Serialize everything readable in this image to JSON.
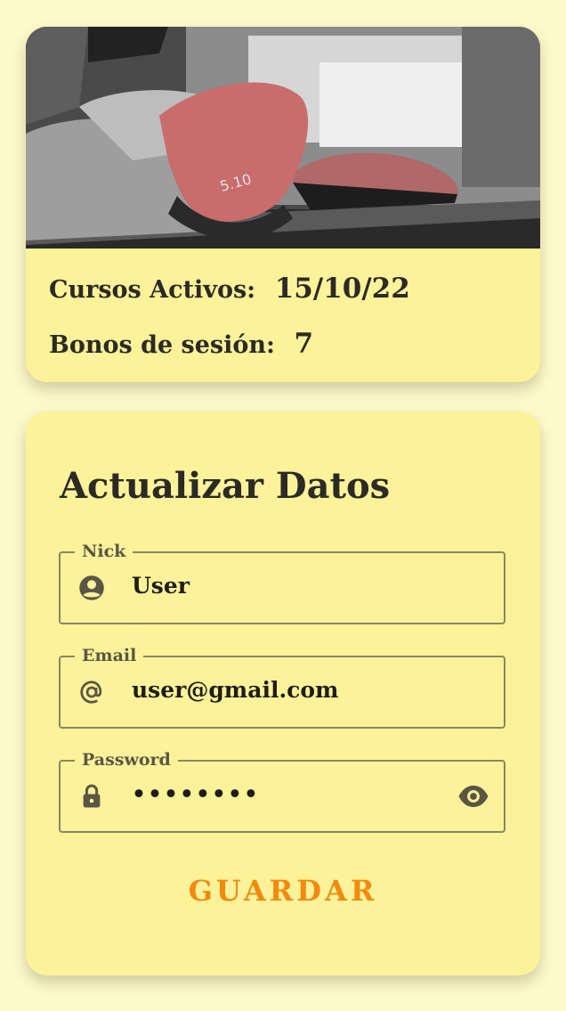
{
  "profile": {
    "cursos_label": "Cursos Activos:",
    "cursos_value": "15/10/22",
    "bonos_label": "Bonos de sesión:",
    "bonos_value": "7"
  },
  "form": {
    "title": "Actualizar Datos",
    "fields": [
      {
        "label": "Nick",
        "value": "User",
        "icon": "account-circle-icon"
      },
      {
        "label": "Email",
        "value": "user@gmail.com",
        "icon": "at-sign-icon"
      },
      {
        "label": "Password",
        "value": "••••••••",
        "icon": "lock-icon",
        "trailing_icon": "eye-icon"
      }
    ],
    "save_label": "GUARDAR"
  },
  "colors": {
    "background": "#fdf9c8",
    "card": "#fcf29a",
    "text": "#2c2a24",
    "accent": "#f28a0e",
    "field_border": "#8b8664"
  }
}
